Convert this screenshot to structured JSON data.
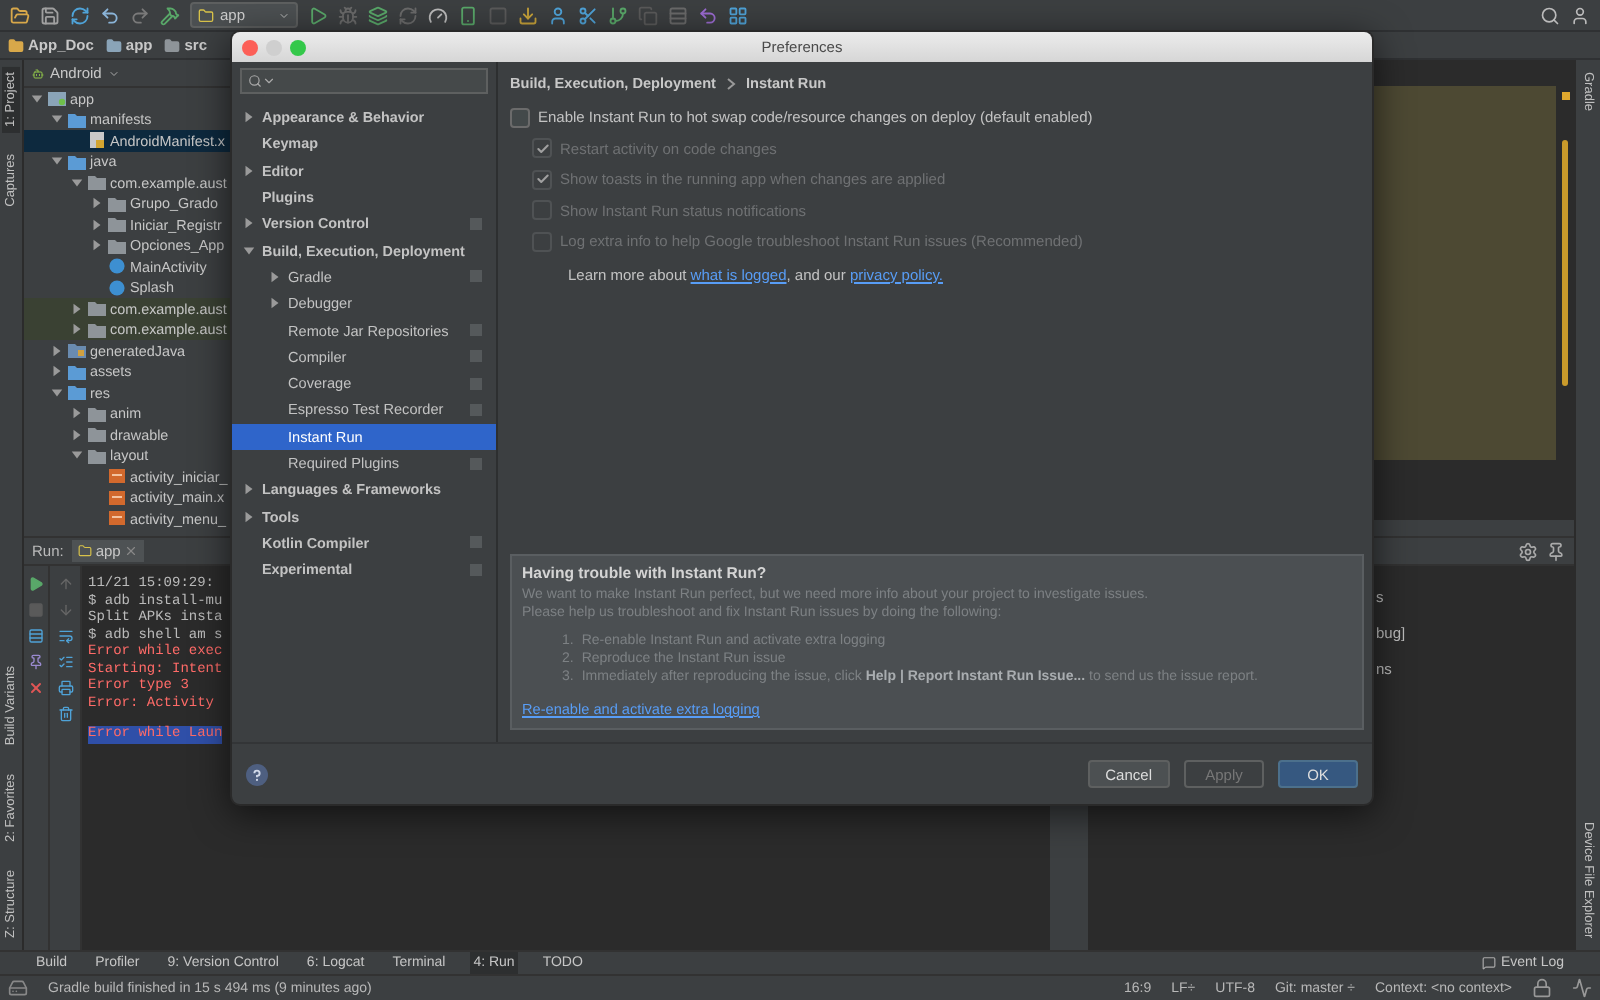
{
  "toolbar": {
    "run_config": "app"
  },
  "breadcrumb": [
    {
      "label": "App_Doc",
      "kind": "project"
    },
    {
      "label": "app",
      "kind": "module"
    },
    {
      "label": "src",
      "kind": "folder"
    }
  ],
  "left_tool_strip": {
    "top": [
      {
        "label": "1: Project",
        "selected": true
      },
      {
        "label": "Captures",
        "selected": false
      }
    ],
    "bottom": [
      {
        "label": "Build Variants",
        "selected": false
      },
      {
        "label": "2: Favorites",
        "selected": false
      },
      {
        "label": "Z: Structure",
        "selected": false
      }
    ]
  },
  "project_panel": {
    "view": "Android",
    "tree": [
      {
        "label": "app",
        "kind": "module",
        "expanded": true,
        "selected": false,
        "children": [
          {
            "label": "manifests",
            "kind": "folder",
            "expanded": true,
            "selected": false,
            "children": [
              {
                "label": "AndroidManifest.x",
                "kind": "manifest",
                "selected": true
              }
            ]
          },
          {
            "label": "java",
            "kind": "folder",
            "expanded": true,
            "selected": false,
            "children": [
              {
                "label": "com.example.aust",
                "kind": "package",
                "expanded": true,
                "selected": false,
                "children": [
                  {
                    "label": "Grupo_Grado",
                    "kind": "package",
                    "expanded": false,
                    "selected": false
                  },
                  {
                    "label": "Iniciar_Registr",
                    "kind": "package",
                    "expanded": false,
                    "selected": false
                  },
                  {
                    "label": "Opciones_App",
                    "kind": "package",
                    "expanded": false,
                    "selected": false
                  },
                  {
                    "label": "MainActivity",
                    "kind": "class",
                    "selected": false
                  },
                  {
                    "label": "Splash",
                    "kind": "class",
                    "selected": false
                  }
                ]
              },
              {
                "label": "com.example.aust",
                "kind": "test-package",
                "expanded": false,
                "selected": false
              },
              {
                "label": "com.example.aust",
                "kind": "test-package",
                "expanded": false,
                "selected": false
              }
            ]
          },
          {
            "label": "generatedJava",
            "kind": "generated",
            "expanded": false,
            "selected": false
          },
          {
            "label": "assets",
            "kind": "folder",
            "expanded": false,
            "selected": false
          },
          {
            "label": "res",
            "kind": "folder",
            "expanded": true,
            "selected": false,
            "children": [
              {
                "label": "anim",
                "kind": "package",
                "expanded": false,
                "selected": false
              },
              {
                "label": "drawable",
                "kind": "package",
                "expanded": false,
                "selected": false
              },
              {
                "label": "layout",
                "kind": "package",
                "expanded": true,
                "selected": false,
                "children": [
                  {
                    "label": "activity_iniciar_",
                    "kind": "xml",
                    "selected": false
                  },
                  {
                    "label": "activity_main.x",
                    "kind": "xml",
                    "selected": false
                  },
                  {
                    "label": "activity_menu_",
                    "kind": "xml",
                    "selected": false
                  }
                ]
              }
            ]
          }
        ]
      }
    ]
  },
  "run_panel": {
    "title": "Run:",
    "tab": "app",
    "console": [
      {
        "text": "11/21 15:09:29:",
        "kind": "info"
      },
      {
        "text": "$ adb install-mu",
        "kind": "info"
      },
      {
        "text": "Split APKs insta",
        "kind": "info"
      },
      {
        "text": "$ adb shell am s",
        "kind": "info"
      },
      {
        "text": "Error while exec",
        "kind": "error"
      },
      {
        "text": "Starting: Intent",
        "kind": "error"
      },
      {
        "text": "Error type 3",
        "kind": "error"
      },
      {
        "text": "Error: Activity",
        "kind": "error"
      },
      {
        "text": "Error while Laun",
        "kind": "highlight"
      }
    ]
  },
  "right_panel_fragments": [
    "s",
    "bug]",
    "ns"
  ],
  "right_tool_strip": {
    "top": [
      {
        "label": "Gradle",
        "selected": false
      }
    ],
    "bottom": [
      {
        "label": "Device File Explorer",
        "selected": false
      }
    ]
  },
  "bottom_tool_bar": [
    {
      "label": "Build",
      "selected": false
    },
    {
      "label": "Profiler",
      "selected": false
    },
    {
      "label": "9: Version Control",
      "selected": false
    },
    {
      "label": "6: Logcat",
      "selected": false
    },
    {
      "label": "Terminal",
      "selected": false
    },
    {
      "label": "4: Run",
      "selected": true
    },
    {
      "label": "TODO",
      "selected": false
    }
  ],
  "event_log": "Event Log",
  "status_bar": {
    "message": "Gradle build finished in 15 s 494 ms (9 minutes ago)",
    "position": "16:9",
    "line_separator": "LF÷",
    "encoding": "UTF-8",
    "vcs": "Git: master ÷",
    "context": "Context: <no context>"
  },
  "dialog": {
    "title": "Preferences",
    "sidebar": [
      {
        "label": "Appearance & Behavior",
        "kind": "branch",
        "expanded": false,
        "selected": false,
        "project_level": false
      },
      {
        "label": "Keymap",
        "kind": "leaf",
        "selected": false,
        "project_level": false
      },
      {
        "label": "Editor",
        "kind": "branch",
        "expanded": false,
        "selected": false,
        "project_level": false
      },
      {
        "label": "Plugins",
        "kind": "leaf",
        "selected": false,
        "project_level": false
      },
      {
        "label": "Version Control",
        "kind": "branch",
        "expanded": false,
        "selected": false,
        "project_level": true
      },
      {
        "label": "Build, Execution, Deployment",
        "kind": "branch",
        "expanded": true,
        "selected": false,
        "project_level": false,
        "children": [
          {
            "label": "Gradle",
            "kind": "branch",
            "expanded": false,
            "selected": false,
            "project_level": true
          },
          {
            "label": "Debugger",
            "kind": "branch",
            "expanded": false,
            "selected": false,
            "project_level": false
          },
          {
            "label": "Remote Jar Repositories",
            "kind": "leaf",
            "selected": false,
            "project_level": true
          },
          {
            "label": "Compiler",
            "kind": "leaf",
            "selected": false,
            "project_level": true
          },
          {
            "label": "Coverage",
            "kind": "leaf",
            "selected": false,
            "project_level": true
          },
          {
            "label": "Espresso Test Recorder",
            "kind": "leaf",
            "selected": false,
            "project_level": true
          },
          {
            "label": "Instant Run",
            "kind": "leaf",
            "selected": true,
            "project_level": false
          },
          {
            "label": "Required Plugins",
            "kind": "leaf",
            "selected": false,
            "project_level": true
          }
        ]
      },
      {
        "label": "Languages & Frameworks",
        "kind": "branch",
        "expanded": false,
        "selected": false,
        "project_level": false
      },
      {
        "label": "Tools",
        "kind": "branch",
        "expanded": false,
        "selected": false,
        "project_level": false
      },
      {
        "label": "Kotlin Compiler",
        "kind": "leaf",
        "selected": false,
        "project_level": true
      },
      {
        "label": "Experimental",
        "kind": "leaf",
        "selected": false,
        "project_level": true
      }
    ],
    "breadcrumb": [
      "Build, Execution, Deployment",
      "Instant Run"
    ],
    "enable_option": {
      "label": "Enable Instant Run to hot swap code/resource changes on deploy (default enabled)",
      "checked": false
    },
    "options": [
      {
        "label": "Restart activity on code changes",
        "checked": true,
        "disabled": true
      },
      {
        "label": "Show toasts in the running app when changes are applied",
        "checked": true,
        "disabled": true
      },
      {
        "label": "Show Instant Run status notifications",
        "checked": false,
        "disabled": true
      },
      {
        "label": "Log extra info to help Google troubleshoot Instant Run issues (Recommended)",
        "checked": false,
        "disabled": true
      }
    ],
    "learn_more": [
      {
        "text": "Learn more about ",
        "kind": "text"
      },
      {
        "text": "what is logged",
        "kind": "link"
      },
      {
        "text": ", and our ",
        "kind": "text"
      },
      {
        "text": "privacy policy.",
        "kind": "link"
      }
    ],
    "trouble": {
      "title": "Having trouble with Instant Run?",
      "paragraphs": [
        "We want to make Instant Run perfect, but we need more info about your project to investigate issues.",
        "Please help us troubleshoot and fix Instant Run issues by doing the following:"
      ],
      "steps": [
        {
          "number": "1.",
          "text": "Re-enable Instant Run and activate extra logging"
        },
        {
          "number": "2.",
          "text": "Reproduce the Instant Run issue"
        },
        {
          "number": "3.",
          "text": "Immediately after reproducing the issue, click **Help | Report Instant Run Issue...** to send us the issue report."
        }
      ],
      "link": "Re-enable and activate extra logging"
    },
    "buttons": [
      {
        "label": "Cancel",
        "kind": "default",
        "disabled": false
      },
      {
        "label": "Apply",
        "kind": "default",
        "disabled": true
      },
      {
        "label": "OK",
        "kind": "primary",
        "disabled": false
      }
    ]
  }
}
